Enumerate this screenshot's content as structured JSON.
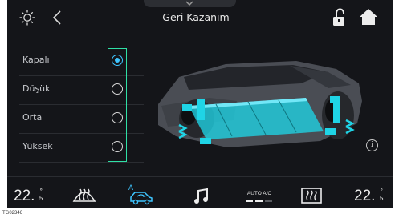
{
  "header": {
    "title": "Geri Kazanım"
  },
  "options": [
    {
      "label": "Kapalı",
      "selected": true
    },
    {
      "label": "Düşük",
      "selected": false
    },
    {
      "label": "Orta",
      "selected": false
    },
    {
      "label": "Yüksek",
      "selected": false
    }
  ],
  "climate": {
    "temp_left": "22.",
    "temp_left_decimal": "5",
    "temp_unit": "°",
    "temp_right": "22.",
    "temp_right_decimal": "5",
    "auto_ac_label": "AUTO A/C",
    "recirc_mode_letter": "A"
  },
  "footer": {
    "figure_code": "TG02346"
  },
  "colors": {
    "accent": "#3ec5ff",
    "highlight_box": "#2fe0a6",
    "battery": "#1fd4e6",
    "background": "#141519"
  },
  "icons": [
    "brightness-icon",
    "back-arrow-icon",
    "unlock-icon",
    "home-icon",
    "front-defrost-icon",
    "car-recirculation-icon",
    "music-icon",
    "rear-defrost-icon",
    "info-icon",
    "chevron-down-icon"
  ]
}
